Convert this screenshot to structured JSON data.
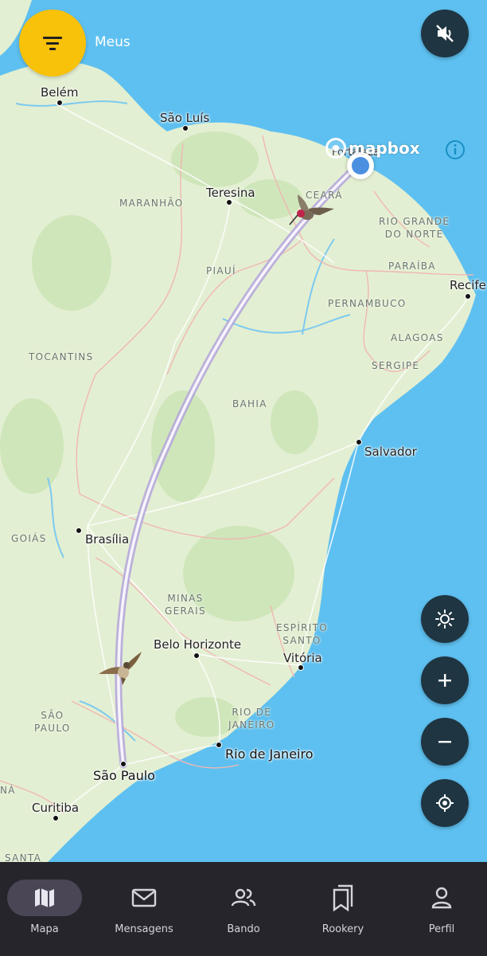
{
  "header": {
    "filter_label": "Meus"
  },
  "map": {
    "attribution": "mapbox",
    "cities": [
      {
        "name": "Belém"
      },
      {
        "name": "São Luís"
      },
      {
        "name": "Teresina"
      },
      {
        "name": "Fortaleza"
      },
      {
        "name": "Recife"
      },
      {
        "name": "Salvador"
      },
      {
        "name": "Brasília"
      },
      {
        "name": "Belo Horizonte"
      },
      {
        "name": "Vitória"
      },
      {
        "name": "Rio de Janeiro"
      },
      {
        "name": "São Paulo"
      },
      {
        "name": "Curitiba"
      }
    ],
    "states": [
      {
        "name": "MARANHÃO"
      },
      {
        "name": "CEARÁ"
      },
      {
        "name": "RIO GRANDE\nDO NORTE"
      },
      {
        "name": "PARAÍBA"
      },
      {
        "name": "PIAUÍ"
      },
      {
        "name": "PERNAMBUCO"
      },
      {
        "name": "ALAGOAS"
      },
      {
        "name": "SERGIPE"
      },
      {
        "name": "TOCANTINS"
      },
      {
        "name": "BAHIA"
      },
      {
        "name": "GOIÁS"
      },
      {
        "name": "MINAS\nGERAIS"
      },
      {
        "name": "ESPÍRITO\nSANTO"
      },
      {
        "name": "RIO DE\nJANEIRO"
      },
      {
        "name": "SÃO\nPAULO"
      },
      {
        "name": "SANTA"
      },
      {
        "name": "NÁ"
      }
    ],
    "route": {
      "from": "São Paulo",
      "to": "Fortaleza"
    },
    "colors": {
      "land": "#e3efd2",
      "water": "#5ec0f0",
      "route": "#c7b9e6",
      "accent": "#f8c10a",
      "fab": "#1f3542"
    }
  },
  "nav": {
    "items": [
      {
        "label": "Mapa",
        "icon": "map-icon",
        "active": true
      },
      {
        "label": "Mensagens",
        "icon": "mail-icon",
        "active": false
      },
      {
        "label": "Bando",
        "icon": "group-icon",
        "active": false
      },
      {
        "label": "Rookery",
        "icon": "bookmarks-icon",
        "active": false
      },
      {
        "label": "Perfil",
        "icon": "person-icon",
        "active": false
      }
    ]
  }
}
